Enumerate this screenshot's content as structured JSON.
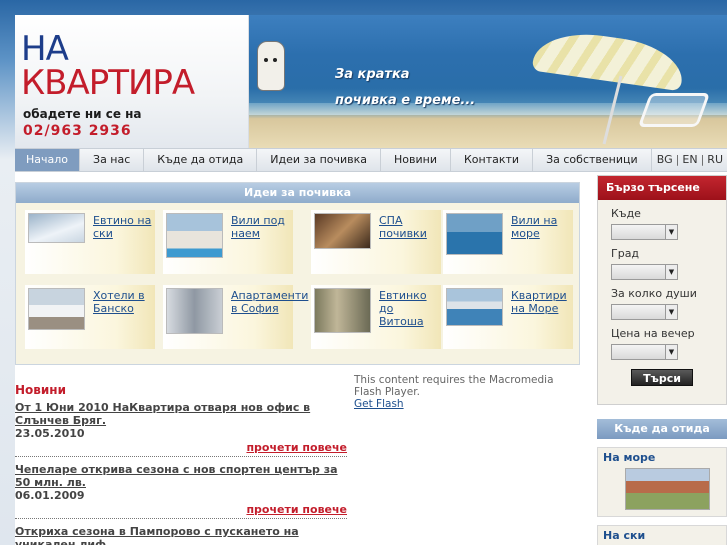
{
  "header": {
    "logo_line1": "НА",
    "logo_line2": "КВАРТИРА",
    "phone_label": "обадете ни се на",
    "phone": "02/963 2936",
    "slogan_line1": "За кратка",
    "slogan_line2": "почивка е време..."
  },
  "nav": {
    "items": [
      "Начало",
      "За нас",
      "Къде да отида",
      "Идеи за почивка",
      "Новини",
      "Контакти",
      "За собственици"
    ],
    "active_index": 0,
    "langs": [
      "BG",
      "EN",
      "RU"
    ]
  },
  "ideas": {
    "title": "Идеи за почивка",
    "items": [
      {
        "label": "Евтино на ски",
        "icon": "ski-photo"
      },
      {
        "label": "Вили под наем",
        "icon": "villa-photo"
      },
      {
        "label": "СПА почивки",
        "icon": "spa-photo"
      },
      {
        "label": "Вили на море",
        "icon": "sea-villa-photo"
      },
      {
        "label": "Хотели в Банско",
        "icon": "bansko-photo"
      },
      {
        "label": "Апартаменти в София",
        "icon": "sofia-photo"
      },
      {
        "label": "Евтинко до Витоша",
        "icon": "vitosha-photo"
      },
      {
        "label": "Квартири на Море",
        "icon": "sea-rooms-photo"
      }
    ]
  },
  "news": {
    "title": "Новини",
    "items": [
      {
        "headline": "От 1 Юни 2010 НаКвартира отваря нов офис в Слънчев Бряг.",
        "date": "23.05.2010",
        "more": "прочети повече"
      },
      {
        "headline": "Чепеларе открива сезона с нов спортен център за 50 млн. лв.",
        "date": "06.01.2009",
        "more": "прочети повече"
      },
      {
        "headline": "Открихa сезона в Пампорово с пускането на уникален лиф",
        "date": "",
        "more": ""
      }
    ]
  },
  "flash": {
    "message": "This content requires the Macromedia Flash Player.",
    "link": "Get Flash"
  },
  "quick_search": {
    "title": "Бързо търсене",
    "fields": [
      {
        "label": "Къде",
        "value": ""
      },
      {
        "label": "Град",
        "value": ""
      },
      {
        "label": "За колко души",
        "value": ""
      },
      {
        "label": "Цена на вечер",
        "value": ""
      }
    ],
    "button": "Търси"
  },
  "destinations": {
    "title": "Къде да отида",
    "items": [
      {
        "label": "На море",
        "icon": "sea-house-photo"
      },
      {
        "label": "На ски",
        "icon": "ski-photo"
      }
    ]
  },
  "colors": {
    "brand_blue": "#1d3d8a",
    "brand_red": "#c31d2b",
    "link_blue": "#1e4f8e",
    "nav_active": "#7f9cbf"
  }
}
